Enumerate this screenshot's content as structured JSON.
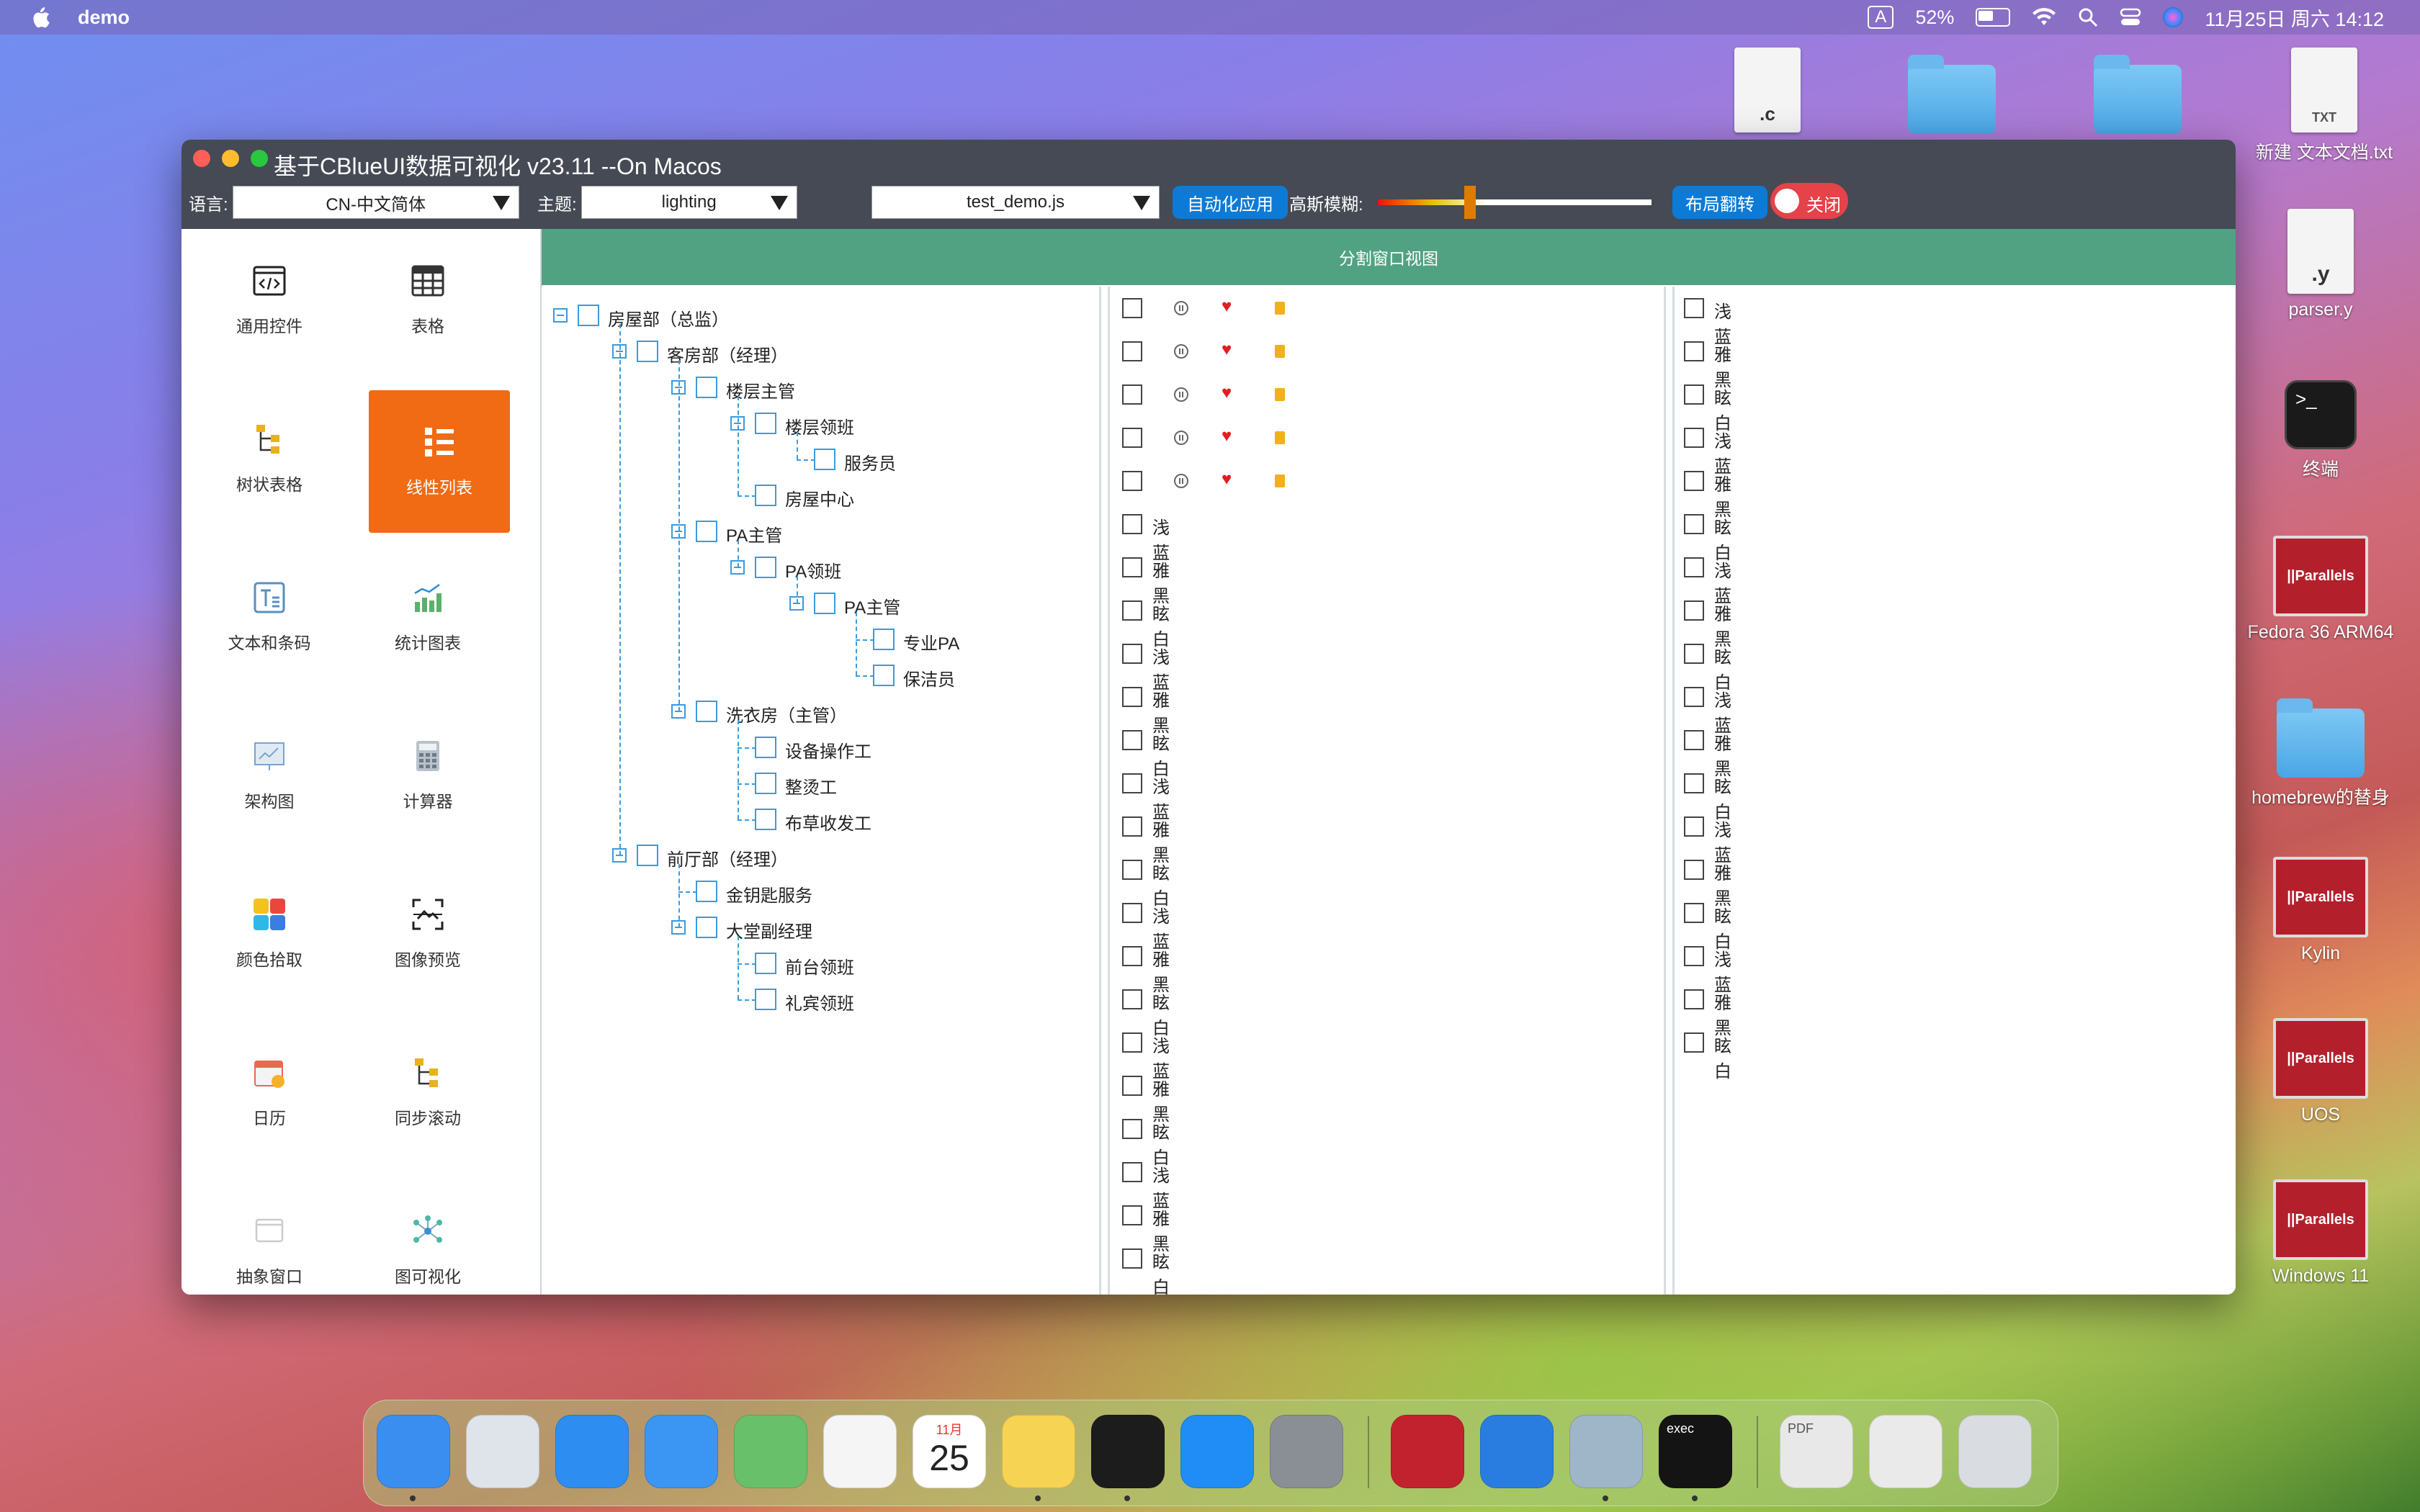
{
  "menubar": {
    "app_name": "demo",
    "ime": "A",
    "battery": "52%",
    "datetime": "11月25日 周六  14:12"
  },
  "desktop": [
    {
      "name": "c-file",
      "label": "",
      "badge": ".c",
      "kind": "doc"
    },
    {
      "name": "folder-1",
      "label": "",
      "kind": "folder"
    },
    {
      "name": "folder-2",
      "label": "",
      "kind": "folder"
    },
    {
      "name": "new-text-doc",
      "label": "新建 文本文档.txt",
      "badge": "TXT",
      "kind": "doc"
    },
    {
      "name": "parser-y",
      "label": "parser.y",
      "badge": ".y",
      "kind": "doc"
    },
    {
      "name": "terminal",
      "label": "终端",
      "kind": "term"
    },
    {
      "name": "fedora",
      "label": "Fedora 36 ARM64",
      "kind": "par"
    },
    {
      "name": "homebrew",
      "label": "homebrew的替身",
      "kind": "folder"
    },
    {
      "name": "kylin",
      "label": "Kylin",
      "kind": "par"
    },
    {
      "name": "uos",
      "label": "UOS",
      "kind": "par"
    },
    {
      "name": "windows11",
      "label": "Windows 11",
      "kind": "par"
    }
  ],
  "parallels_text": "||Parallels",
  "window": {
    "title": "基于CBlueUI数据可视化 v23.11 --On Macos",
    "lang_label": "语言:",
    "lang_value": "CN-中文简体",
    "theme_label": "主题:",
    "theme_value": "lighting",
    "script_value": "test_demo.js",
    "auto_button": "自动化应用",
    "blur_label": "高斯模糊:",
    "blur_level": 0.33,
    "flip_button": "布局翻转",
    "toggle_label": "关闭"
  },
  "nav": [
    "通用控件",
    "表格",
    "树状表格",
    "线性列表",
    "文本和条码",
    "统计图表",
    "架构图",
    "计算器",
    "颜色拾取",
    "图像预览",
    "日历",
    "同步滚动",
    "抽象窗口",
    "图可视化"
  ],
  "nav_active": "线性列表",
  "content_header": "分割窗口视图",
  "tree": [
    {
      "label": "房屋部（总监）",
      "level": 0,
      "expand": true
    },
    {
      "label": "客房部（经理）",
      "level": 1,
      "expand": true
    },
    {
      "label": "楼层主管",
      "level": 2,
      "expand": true
    },
    {
      "label": "楼层领班",
      "level": 3,
      "expand": true
    },
    {
      "label": "服务员",
      "level": 4,
      "expand": false
    },
    {
      "label": "房屋中心",
      "level": 3,
      "expand": false
    },
    {
      "label": "PA主管",
      "level": 2,
      "expand": true
    },
    {
      "label": "PA领班",
      "level": 3,
      "expand": true
    },
    {
      "label": "PA主管",
      "level": 4,
      "expand": true
    },
    {
      "label": "专业PA",
      "level": 5,
      "expand": false
    },
    {
      "label": "保洁员",
      "level": 5,
      "expand": false
    },
    {
      "label": "洗衣房（主管）",
      "level": 2,
      "expand": true
    },
    {
      "label": "设备操作工",
      "level": 3,
      "expand": false
    },
    {
      "label": "整烫工",
      "level": 3,
      "expand": false
    },
    {
      "label": "布草收发工",
      "level": 3,
      "expand": false
    },
    {
      "label": "前厅部（经理）",
      "level": 1,
      "expand": true
    },
    {
      "label": "金钥匙服务",
      "level": 2,
      "expand": false
    },
    {
      "label": "大堂副经理",
      "level": 2,
      "expand": true
    },
    {
      "label": "前台领班",
      "level": 3,
      "expand": false
    },
    {
      "label": "礼宾领班",
      "level": 3,
      "expand": false
    }
  ],
  "middle_icon_rows": 5,
  "middle_list": [
    "浅蓝",
    "雅黑",
    "眩白",
    "浅蓝",
    "雅黑",
    "眩白",
    "浅蓝",
    "雅黑",
    "眩白",
    "浅蓝",
    "雅黑",
    "眩白",
    "浅蓝",
    "雅黑",
    "眩白",
    "浅蓝",
    "雅黑",
    "眩白"
  ],
  "right_list": [
    "浅蓝",
    "雅黑",
    "眩白",
    "浅蓝",
    "雅黑",
    "眩白",
    "浅蓝",
    "雅黑",
    "眩白",
    "浅蓝",
    "雅黑",
    "眩白",
    "浅蓝",
    "雅黑",
    "眩白",
    "浅蓝",
    "雅黑",
    "眩白"
  ],
  "dock": [
    {
      "name": "finder",
      "color": "#3a8ef0"
    },
    {
      "name": "launchpad",
      "color": "#dfe3ea"
    },
    {
      "name": "safari",
      "color": "#2d8df0"
    },
    {
      "name": "mail",
      "color": "#3b95f2"
    },
    {
      "name": "maps",
      "color": "#69c06a"
    },
    {
      "name": "photos",
      "color": "#f5f5f5"
    },
    {
      "name": "calendar",
      "color": "#ffffff",
      "month": "11月",
      "day": "25"
    },
    {
      "name": "notes",
      "color": "#f7d354"
    },
    {
      "name": "terminal",
      "color": "#1c1c1c"
    },
    {
      "name": "app-store",
      "color": "#1f8df5"
    },
    {
      "name": "system-settings",
      "color": "#8a8f96"
    },
    {
      "name": "parallels",
      "color": "#c2222e"
    },
    {
      "name": "xcode",
      "color": "#2a7de0"
    },
    {
      "name": "preview",
      "color": "#9fb5c8"
    },
    {
      "name": "exec",
      "color": "#141414",
      "label": "exec"
    },
    {
      "name": "pdf",
      "color": "#e8e8e8",
      "label": "PDF"
    },
    {
      "name": "screenshot",
      "color": "#eaeaea"
    },
    {
      "name": "trash",
      "color": "#d9dde2"
    }
  ]
}
